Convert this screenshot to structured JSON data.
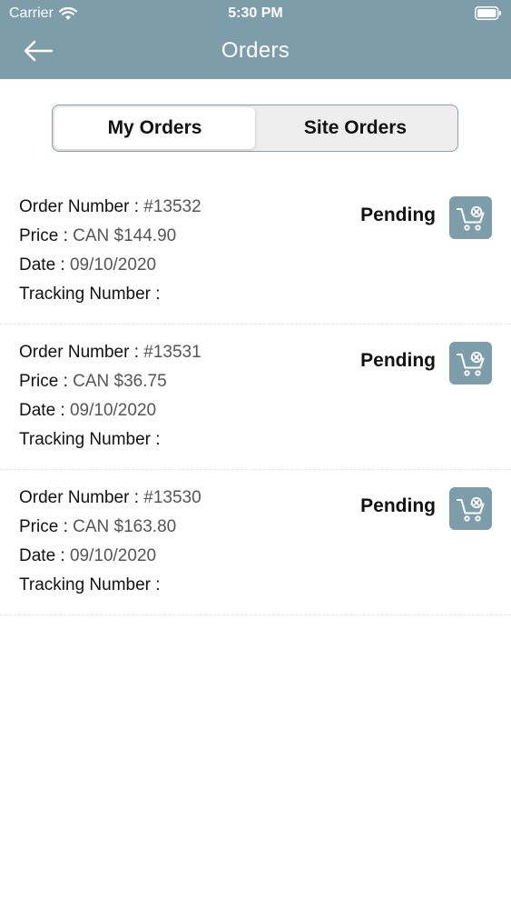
{
  "status_bar": {
    "carrier": "Carrier",
    "time": "5:30 PM"
  },
  "header": {
    "title": "Orders",
    "back_icon": "arrow-left-icon",
    "background_color": "#7e9dab"
  },
  "tabs": [
    {
      "label": "My Orders",
      "selected": true
    },
    {
      "label": "Site Orders",
      "selected": false
    }
  ],
  "labels": {
    "order_number": "Order Number : ",
    "price": "Price : ",
    "date": "Date : ",
    "tracking": "Tracking Number : "
  },
  "orders": [
    {
      "number": "#13532",
      "price": "CAN $144.90",
      "date": "09/10/2020",
      "tracking": "",
      "status": "Pending",
      "action_icon": "cart-cancel-icon"
    },
    {
      "number": "#13531",
      "price": "CAN $36.75",
      "date": "09/10/2020",
      "tracking": "",
      "status": "Pending",
      "action_icon": "cart-cancel-icon"
    },
    {
      "number": "#13530",
      "price": "CAN $163.80",
      "date": "09/10/2020",
      "tracking": "",
      "status": "Pending",
      "action_icon": "cart-cancel-icon"
    }
  ]
}
